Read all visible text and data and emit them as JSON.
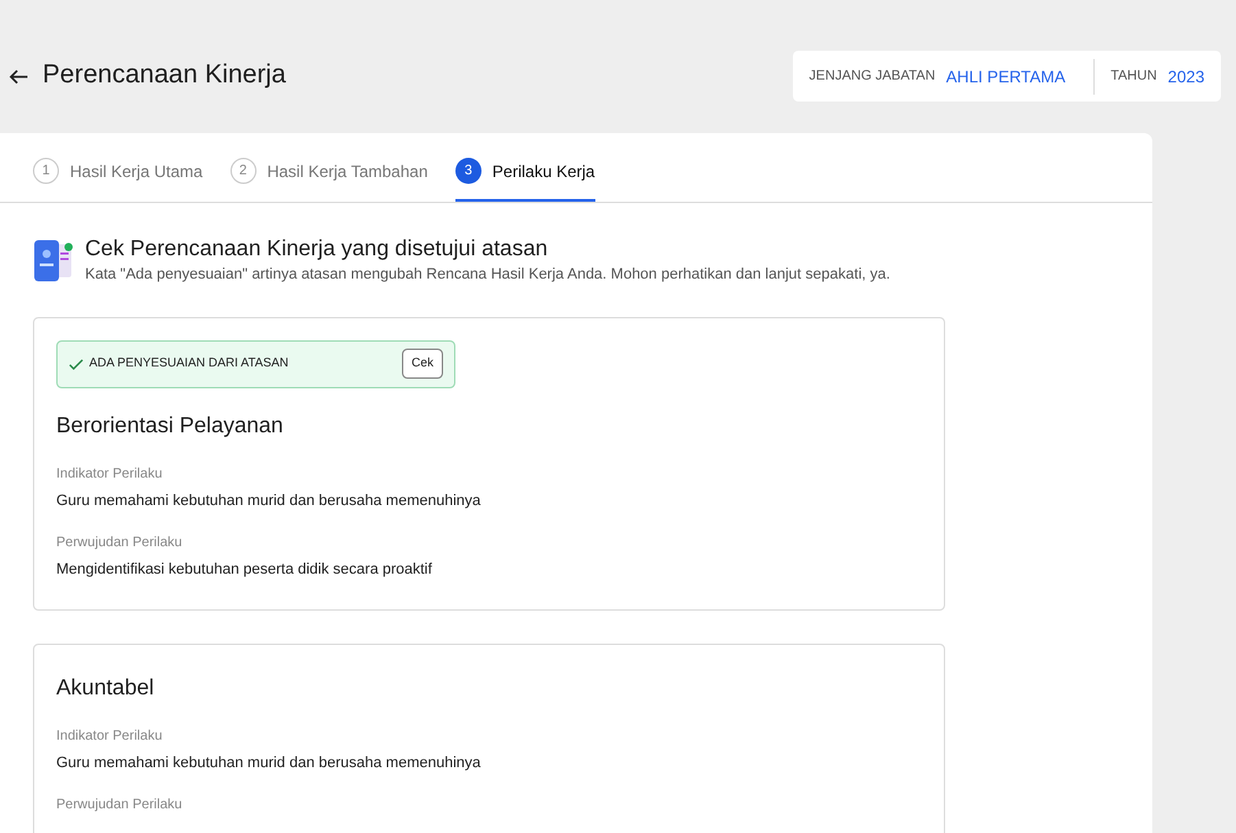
{
  "header": {
    "title": "Perencanaan Kinerja",
    "jenjang_label": "JENJANG JABATAN",
    "jenjang_value": "AHLI PERTAMA",
    "tahun_label": "TAHUN",
    "tahun_value": "2023"
  },
  "tabs": [
    {
      "number": "1",
      "label": "Hasil Kerja Utama",
      "selected": false
    },
    {
      "number": "2",
      "label": "Hasil Kerja Tambahan",
      "selected": false
    },
    {
      "number": "3",
      "label": "Perilaku Kerja",
      "selected": true
    }
  ],
  "intro": {
    "title": "Cek Perencanaan Kinerja yang disetujui atasan",
    "description": "Kata \"Ada penyesuaian\" artinya atasan mengubah Rencana Hasil Kerja Anda. Mohon perhatikan dan lanjut sepakati, ya."
  },
  "cards": [
    {
      "adjusted": true,
      "adjustment_label": "ADA PENYESUAIAN DARI ATASAN",
      "check_button": "Cek",
      "title": "Berorientasi Pelayanan",
      "fields": [
        {
          "label": "Indikator Perilaku",
          "value": "Guru memahami kebutuhan murid dan berusaha memenuhinya"
        },
        {
          "label": "Perwujudan Perilaku",
          "value": "Mengidentifikasi kebutuhan peserta didik secara proaktif"
        }
      ]
    },
    {
      "adjusted": false,
      "title": "Akuntabel",
      "fields": [
        {
          "label": "Indikator Perilaku",
          "value": "Guru memahami kebutuhan murid dan berusaha memenuhinya"
        },
        {
          "label": "Perwujudan Perilaku"
        }
      ]
    }
  ]
}
